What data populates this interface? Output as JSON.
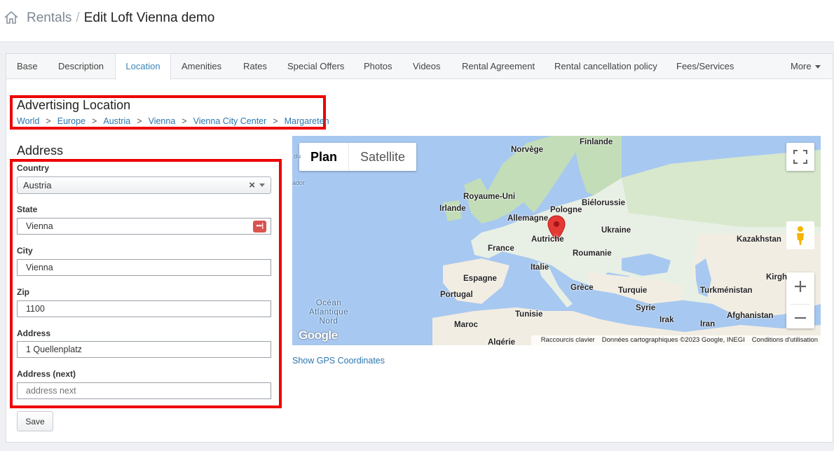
{
  "header": {
    "breadcrumb_parent": "Rentals",
    "breadcrumb_separator": "/",
    "breadcrumb_current": "Edit Loft Vienna demo"
  },
  "tabs": [
    {
      "label": "Base",
      "active": false
    },
    {
      "label": "Description",
      "active": false
    },
    {
      "label": "Location",
      "active": true
    },
    {
      "label": "Amenities",
      "active": false
    },
    {
      "label": "Rates",
      "active": false
    },
    {
      "label": "Special Offers",
      "active": false
    },
    {
      "label": "Photos",
      "active": false
    },
    {
      "label": "Videos",
      "active": false
    },
    {
      "label": "Rental Agreement",
      "active": false
    },
    {
      "label": "Rental cancellation policy",
      "active": false
    },
    {
      "label": "Fees/Services",
      "active": false
    },
    {
      "label": "More",
      "active": false
    }
  ],
  "advertising_location": {
    "title": "Advertising Location",
    "path": [
      "World",
      "Europe",
      "Austria",
      "Vienna",
      "Vienna City Center",
      "Margareten"
    ],
    "separator": ">"
  },
  "address": {
    "title": "Address",
    "country": {
      "label": "Country",
      "value": "Austria",
      "clear_glyph": "×"
    },
    "state": {
      "label": "State",
      "value": "Vienna"
    },
    "city": {
      "label": "City",
      "value": "Vienna"
    },
    "zip": {
      "label": "Zip",
      "value": "1100"
    },
    "address": {
      "label": "Address",
      "value": "1 Quellenplatz"
    },
    "address_next": {
      "label": "Address (next)",
      "placeholder": "address next"
    },
    "save_label": "Save"
  },
  "map": {
    "mode_plan": "Plan",
    "mode_satellite": "Satellite",
    "active_mode": "Plan",
    "logo": "Google",
    "attribution": {
      "shortcuts": "Raccourcis clavier",
      "data": "Données cartographiques ©2023 Google, INEGI",
      "terms": "Conditions d'utilisation"
    },
    "labels": {
      "finlande": "Finlande",
      "norvege": "Norvège",
      "du": "du",
      "ador": "ador",
      "royaume_uni": "Royaume-Uni",
      "irlande": "Irlande",
      "bielorussie": "Biélorussie",
      "pologne": "Pologne",
      "allemagne": "Allemagne",
      "ukraine": "Ukraine",
      "kazakhstan": "Kazakhstan",
      "autriche": "Autriche",
      "france": "France",
      "roumanie": "Roumanie",
      "italie": "Italie",
      "espagne": "Espagne",
      "grece": "Grèce",
      "turquie": "Turquie",
      "turkmenistan": "Turkménistan",
      "kirgh": "Kirgh",
      "portugal": "Portugal",
      "ocean_1": "Océan",
      "ocean_2": "Atlantique",
      "ocean_3": "Nord",
      "syrie": "Syrie",
      "tunisie": "Tunisie",
      "afghanistan": "Afghanistan",
      "irak": "Irak",
      "iran": "Iran",
      "maroc": "Maroc",
      "algerie": "Algérie"
    },
    "icons": [
      "fullscreen-icon",
      "pegman-icon",
      "zoom-in-icon",
      "zoom-out-icon",
      "map-pin-icon"
    ],
    "colors": {
      "water": "#a7c8f0",
      "land": "#e8efe4",
      "forest": "#c3ddb8",
      "desert": "#f2ede2",
      "pin": "#e53935"
    }
  },
  "gps_link": "Show GPS Coordinates",
  "colors": {
    "accent": "#2c77ad",
    "highlight_border": "#ee0000",
    "tab_active_text": "#3a86b8"
  }
}
